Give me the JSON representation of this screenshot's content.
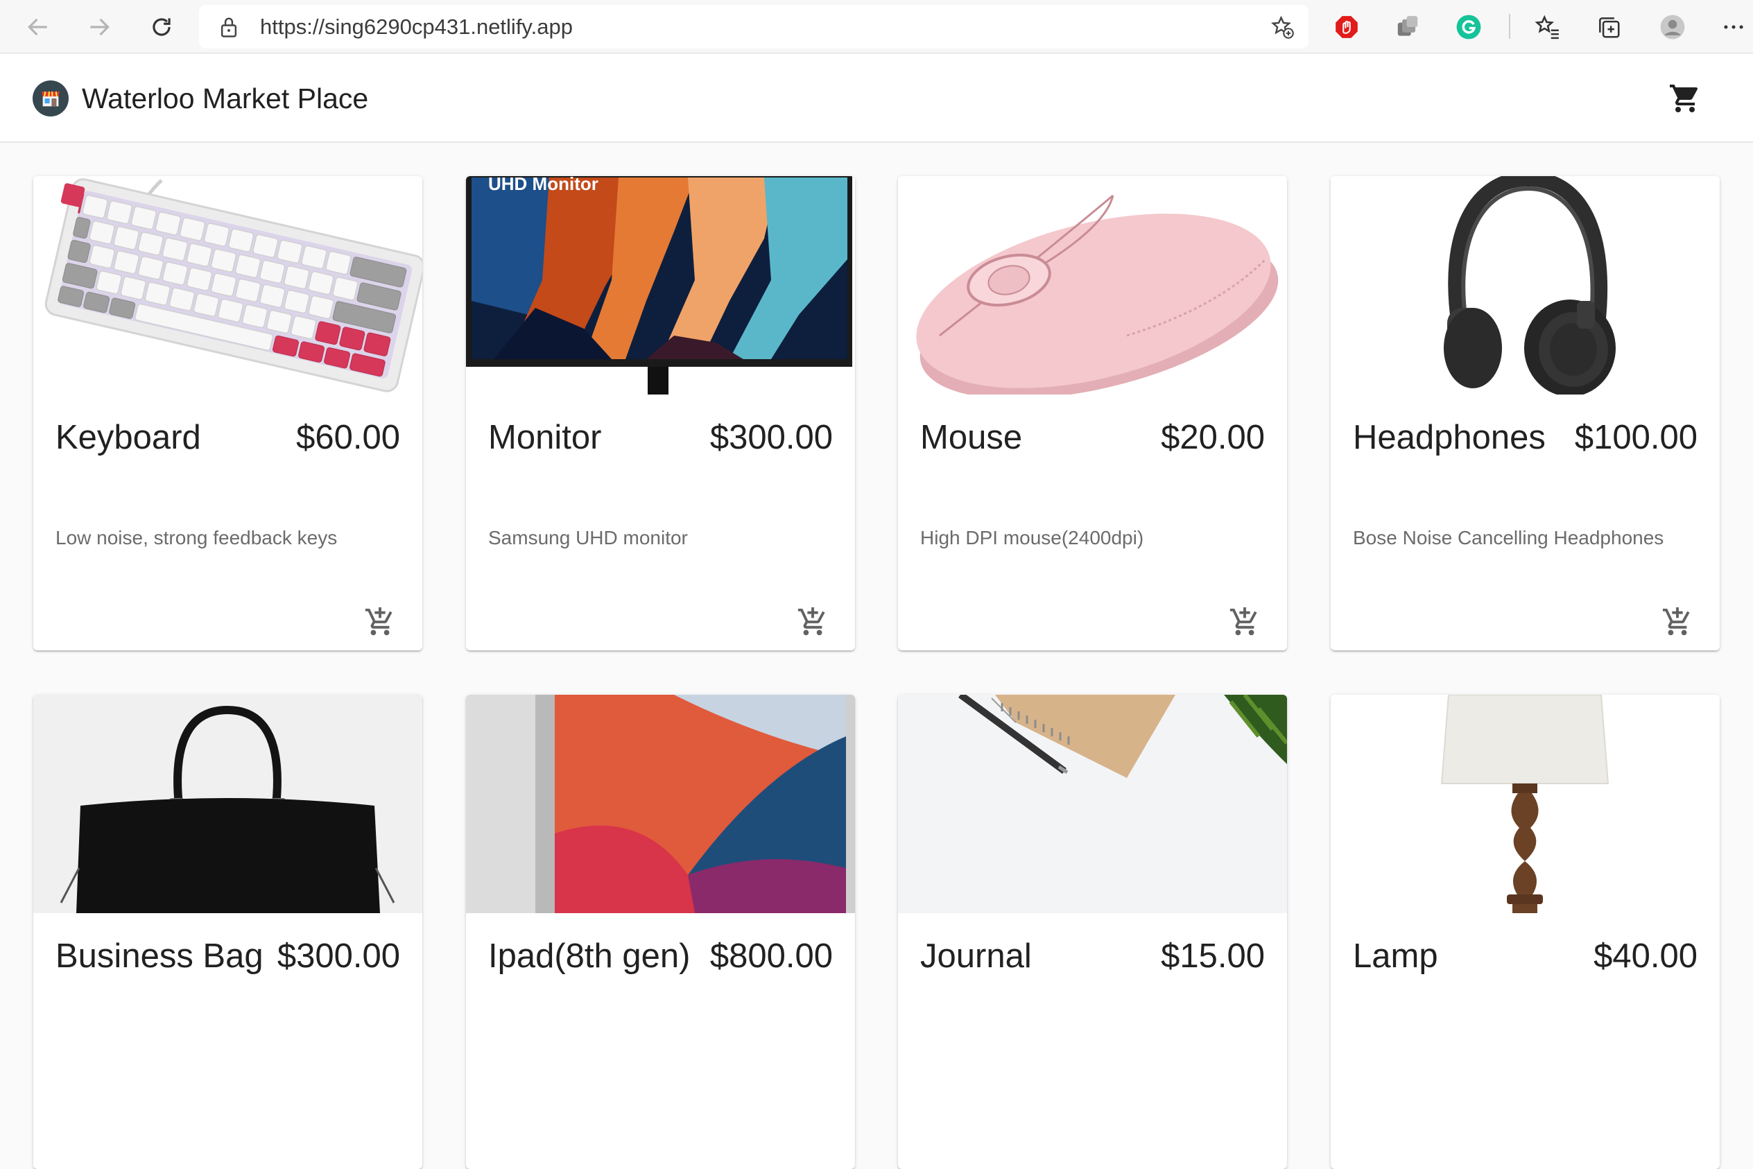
{
  "browser": {
    "url": "https://sing6290cp431.netlify.app",
    "icons": [
      "back-icon",
      "forward-icon",
      "refresh-icon",
      "lock-icon",
      "add-favorite-icon",
      "adblock-extension-icon",
      "extension-icon",
      "grammarly-icon",
      "favorites-icon",
      "collections-icon",
      "profile-avatar",
      "more-icon"
    ]
  },
  "app": {
    "title": "Waterloo Market Place",
    "logo_icon": "store-icon",
    "cart_icon": "shopping-cart-icon"
  },
  "products": [
    {
      "name": "Keyboard",
      "price": "$60.00",
      "description": "Low noise, strong feedback keys",
      "image": "keyboard-image"
    },
    {
      "name": "Monitor",
      "price": "$300.00",
      "description": "Samsung UHD monitor",
      "image": "monitor-image",
      "image_caption": "UHD Monitor"
    },
    {
      "name": "Mouse",
      "price": "$20.00",
      "description": "High DPI mouse(2400dpi)",
      "image": "mouse-image"
    },
    {
      "name": "Headphones",
      "price": "$100.00",
      "description": "Bose Noise Cancelling Headphones",
      "image": "headphones-image"
    },
    {
      "name": "Business Bag",
      "price": "$300.00",
      "description": "",
      "image": "bag-image"
    },
    {
      "name": "Ipad(8th gen)",
      "price": "$800.00",
      "description": "",
      "image": "ipad-image"
    },
    {
      "name": "Journal",
      "price": "$15.00",
      "description": "",
      "image": "journal-image"
    },
    {
      "name": "Lamp",
      "price": "$40.00",
      "description": "",
      "image": "lamp-image"
    }
  ],
  "colors": {
    "accent_red": "#e21b1b",
    "grammarly_green": "#15c39a",
    "app_text": "#212121",
    "description_text": "#6b6b6b"
  }
}
